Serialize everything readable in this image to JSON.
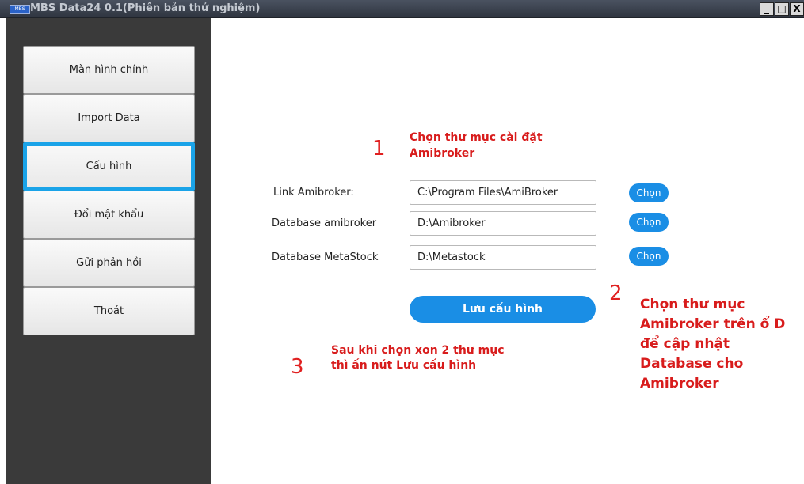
{
  "window": {
    "logo_text": "MBS",
    "title": "MBS Data24 0.1(Phiên bản thử nghiệm)",
    "minimize_label": "_",
    "maximize_label": "□",
    "close_label": "X"
  },
  "sidebar": {
    "items": [
      {
        "label": "Màn hình chính"
      },
      {
        "label": "Import Data"
      },
      {
        "label": "Cấu hình"
      },
      {
        "label": "Đổi mật khẩu"
      },
      {
        "label": "Gửi phản hồi"
      },
      {
        "label": "Thoát"
      }
    ],
    "active_index": 2
  },
  "form": {
    "rows": [
      {
        "label": "Link Amibroker:",
        "value": "C:\\Program Files\\AmiBroker",
        "button": "Chọn"
      },
      {
        "label": "Database amibroker",
        "value": "D:\\Amibroker",
        "button": "Chọn"
      },
      {
        "label": "Database MetaStock",
        "value": "D:\\Metastock",
        "button": "Chọn"
      }
    ],
    "save_label": "Lưu cấu hình"
  },
  "annotations": {
    "step1": {
      "number": "1",
      "text": "Chọn thư mục cài đặt Amibroker"
    },
    "step2": {
      "number": "2",
      "text": "Chọn thư mục Amibroker trên ổ D để cập nhật Database cho Amibroker"
    },
    "step3": {
      "number": "3",
      "text": "Sau khi chọn xon 2 thư mục thì ấn nút Lưu cấu hình"
    }
  },
  "colors": {
    "accent": "#1a8ee5",
    "active_border": "#1aa3e8",
    "annotation_red": "#d81c1c",
    "sidebar_bg": "#3a3a3a"
  }
}
